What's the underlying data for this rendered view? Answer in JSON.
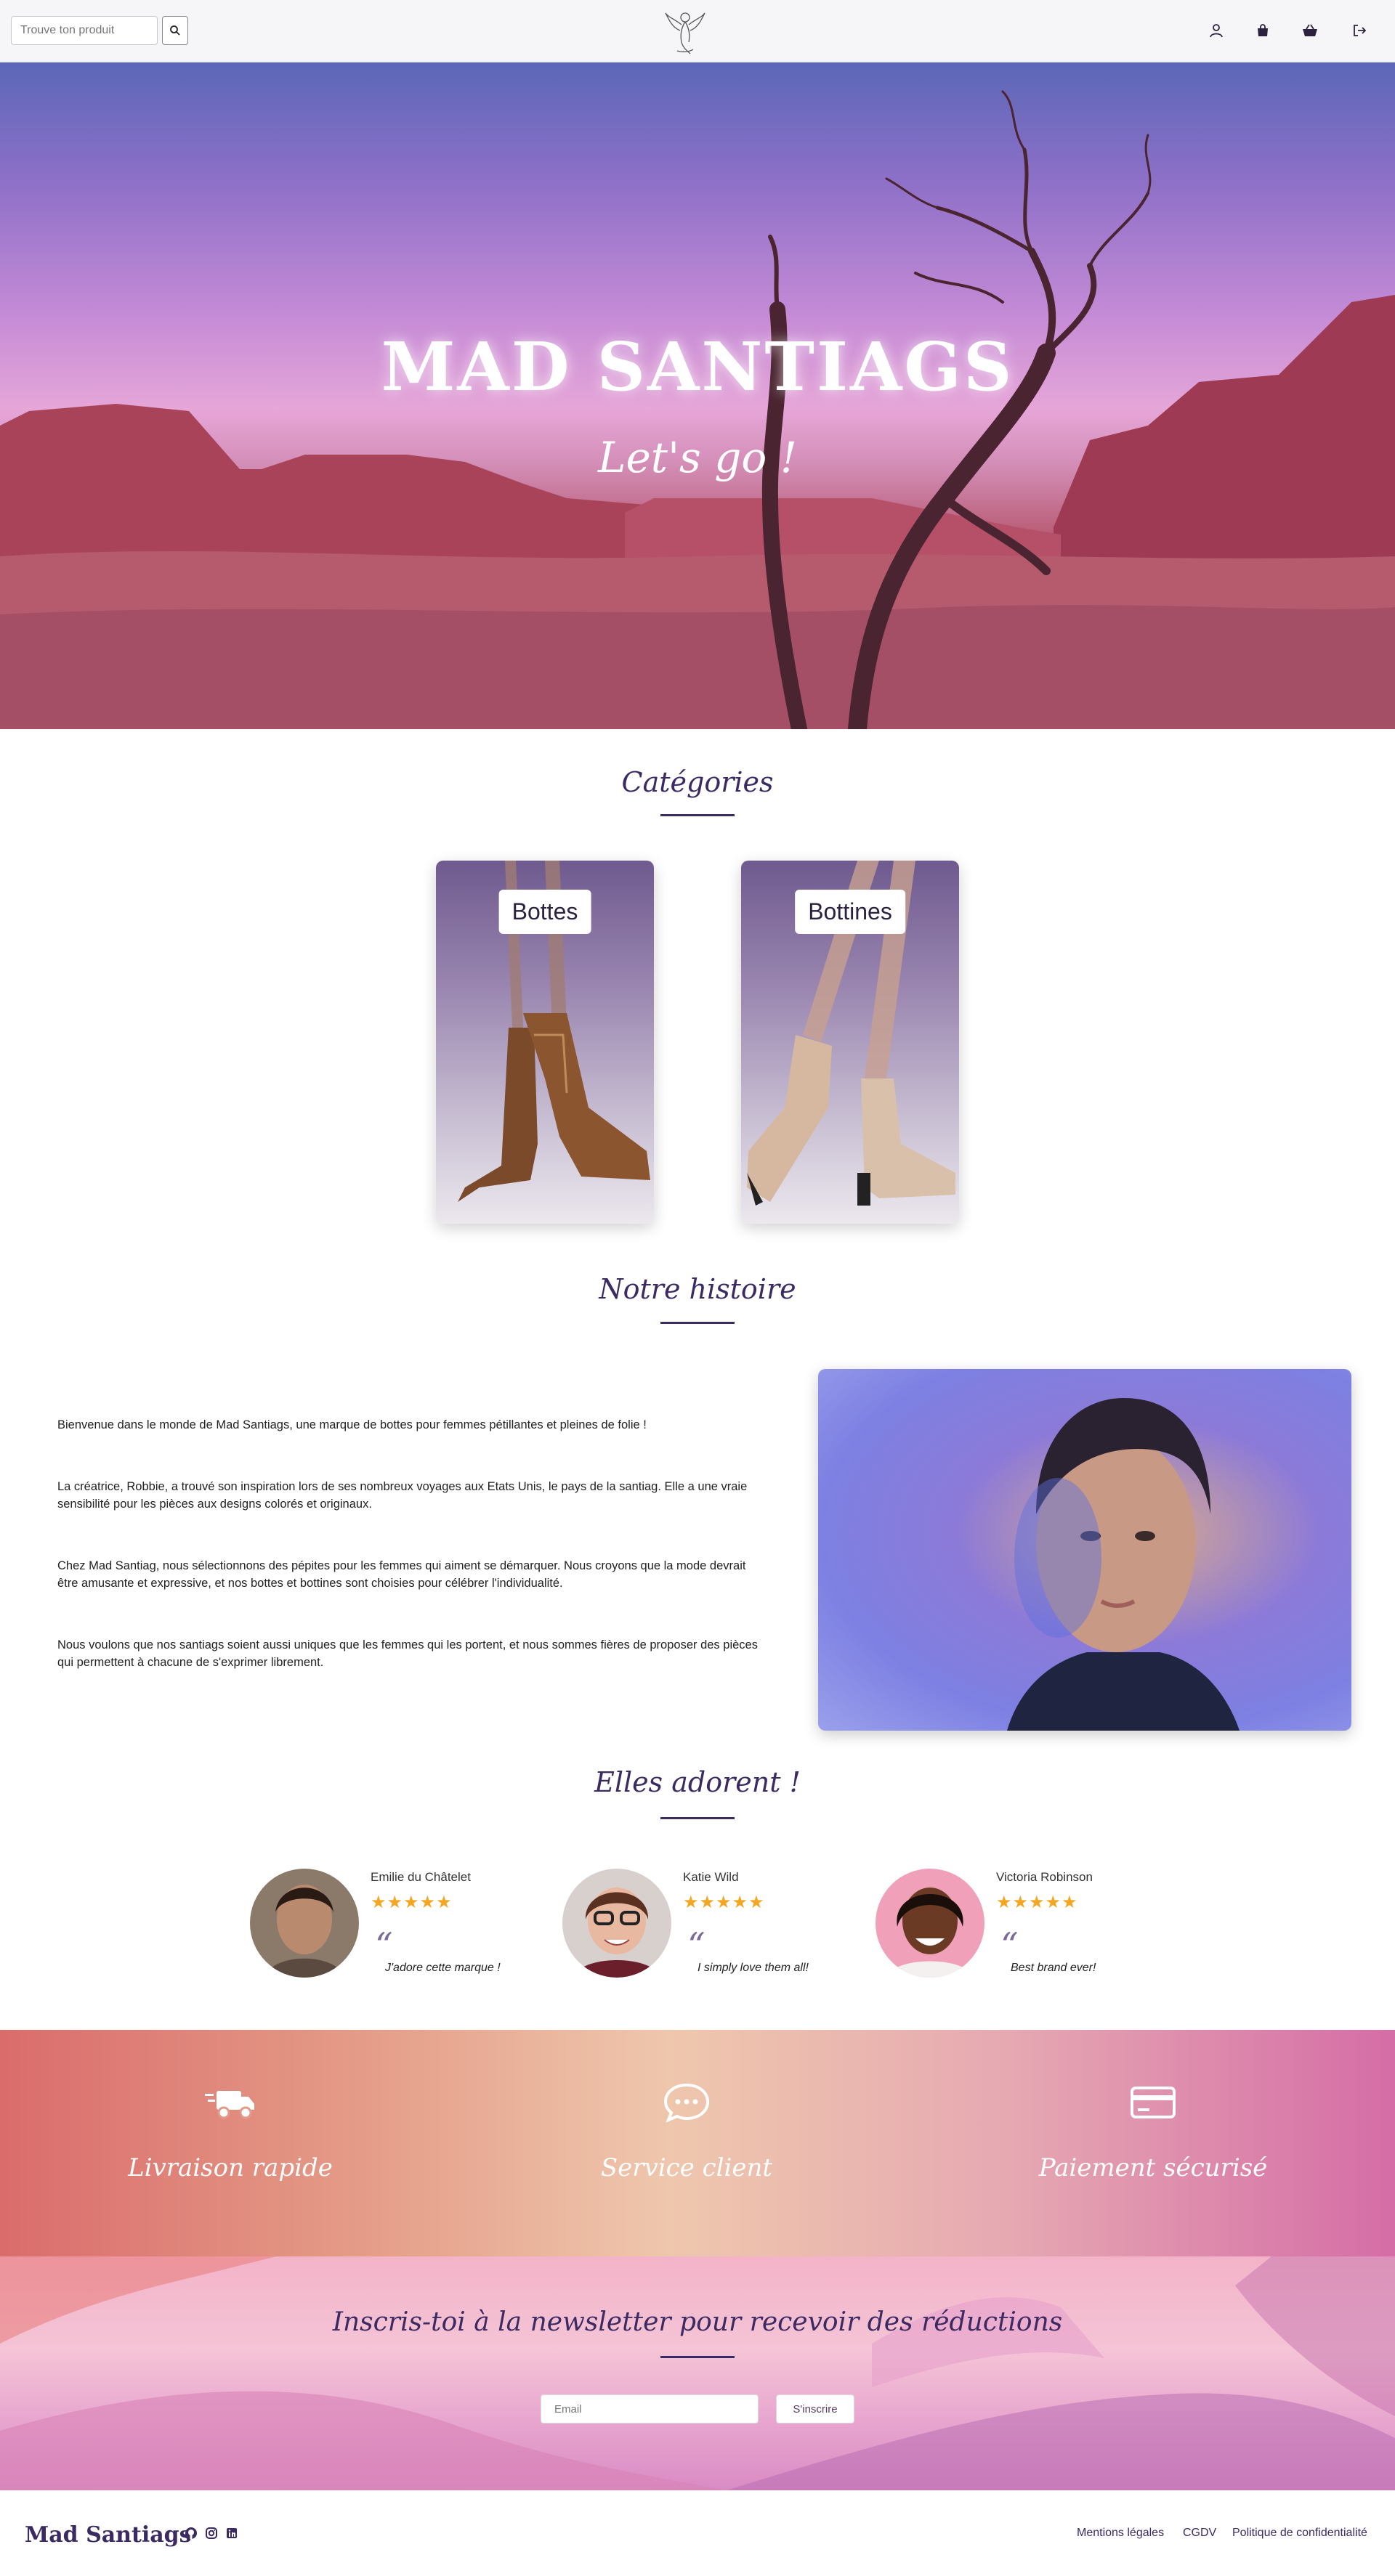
{
  "header": {
    "search_placeholder": "Trouve ton produit",
    "icons": [
      "search-icon",
      "logo-angel",
      "user-icon",
      "bag-icon",
      "basket-icon",
      "logout-icon"
    ]
  },
  "hero": {
    "title": "MAD SANTIAGS",
    "subtitle": "Let's go !"
  },
  "categories": {
    "title": "Catégories",
    "items": [
      {
        "label": "Bottes"
      },
      {
        "label": "Bottines"
      }
    ]
  },
  "story": {
    "title": "Notre histoire",
    "paragraphs": [
      "Bienvenue dans le monde de Mad Santiags, une marque de bottes pour femmes pétillantes et pleines de folie !",
      "La créatrice, Robbie, a trouvé son inspiration lors de ses nombreux voyages aux Etats Unis, le pays de la santiag. Elle a une vraie sensibilité pour les pièces aux designs colorés et originaux.",
      "Chez Mad Santiag, nous sélectionnons des pépites pour les femmes qui aiment se démarquer. Nous croyons que la mode devrait être amusante et expressive, et nos bottes et bottines sont choisies pour célébrer l'individualité.",
      "Nous voulons que nos santiags soient aussi uniques que les femmes qui les portent, et nous sommes fières de proposer des pièces qui permettent à chacune de s'exprimer librement."
    ]
  },
  "reviews": {
    "title": "Elles adorent !",
    "items": [
      {
        "name": "Emilie du Châtelet",
        "stars": "★★★★★",
        "rating": 5,
        "text": "J'adore cette marque !"
      },
      {
        "name": "Katie Wild",
        "stars": "★★★★★",
        "rating": 5,
        "text": "I simply love them all!"
      },
      {
        "name": "Victoria Robinson",
        "stars": "★★★★★",
        "rating": 5,
        "text": "Best brand ever!"
      }
    ]
  },
  "features": [
    {
      "label": "Livraison rapide",
      "icon": "truck-fast-icon"
    },
    {
      "label": "Service client",
      "icon": "chat-icon"
    },
    {
      "label": "Paiement sécurisé",
      "icon": "credit-card-icon"
    }
  ],
  "newsletter": {
    "title": "Inscris-toi à la newsletter pour recevoir des réductions",
    "email_placeholder": "Email",
    "button": "S'inscrire"
  },
  "footer": {
    "brand": "Mad Santiags",
    "social_icons": [
      "github-icon",
      "instagram-icon",
      "linkedin-icon"
    ],
    "links": [
      "Mentions légales",
      "CGDV",
      "Politique de confidentialité"
    ]
  },
  "colors": {
    "primary": "#3c2a63",
    "star": "#f5a623"
  }
}
